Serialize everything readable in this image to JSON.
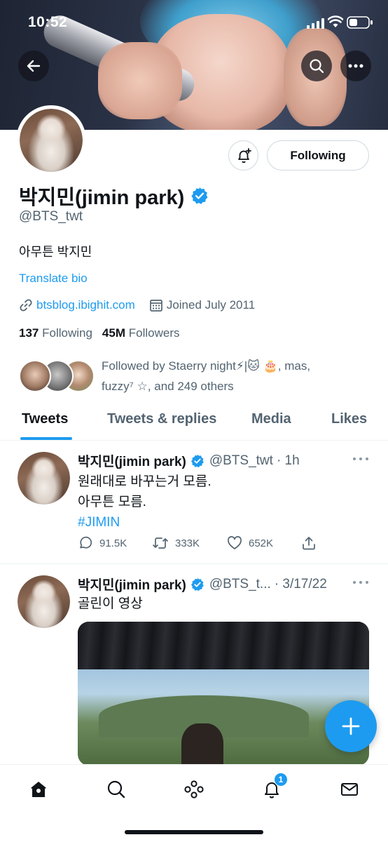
{
  "status_bar": {
    "time": "10:52"
  },
  "profile": {
    "name": "박지민(jimin park)",
    "handle": "@BTS_twt",
    "bio": "아무튼 박지민",
    "translate_label": "Translate bio",
    "website": "btsblog.ibighit.com",
    "joined": "Joined July 2011",
    "following_count": "137",
    "following_label": "Following",
    "followers_count": "45M",
    "followers_label": "Followers",
    "follow_button_label": "Following",
    "followed_by_line1": "Followed by Staerry night⚡|🐱 🎂, mas,",
    "followed_by_line2": "fuzzy⁷ ☆, and 249 others"
  },
  "tabs": [
    {
      "label": "Tweets",
      "active": true
    },
    {
      "label": "Tweets & replies",
      "active": false
    },
    {
      "label": "Media",
      "active": false
    },
    {
      "label": "Likes",
      "active": false
    }
  ],
  "tweets": [
    {
      "name": "박지민(jimin park)",
      "handle": "@BTS_twt",
      "time": "· 1h",
      "line1": "원래대로 바꾸는거 모름.",
      "line2": "아무튼 모름.",
      "hashtag": "#JIMIN",
      "replies": "91.5K",
      "retweets": "333K",
      "likes": "652K"
    },
    {
      "name": "박지민(jimin park)",
      "handle": "@BTS_t...",
      "time": "· 3/17/22",
      "line1": "골린이 영상"
    }
  ],
  "notifications_badge": "1",
  "colors": {
    "accent": "#1d9bf0",
    "text": "#0f1419",
    "secondary": "#536471"
  }
}
